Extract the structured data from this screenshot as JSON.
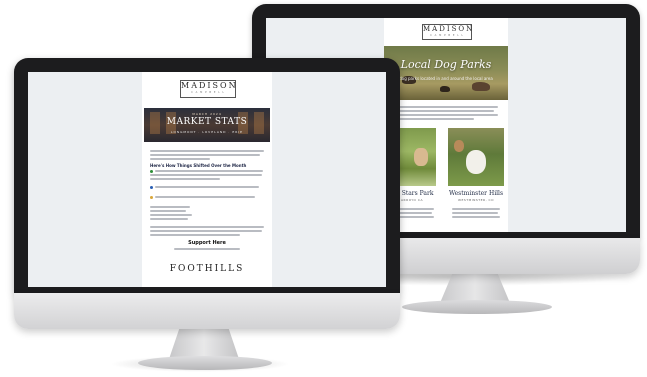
{
  "back_email": {
    "brand": "MADISON",
    "brand_sub": "C A M P B E L L",
    "hero_title": "Local Dog Parks",
    "hero_subtitle": "dog parks located in and around the local area",
    "parks": [
      {
        "name": "ald Stars Park",
        "city": "ARROYO CA"
      },
      {
        "name": "Westminster Hills",
        "city": "WESTMINSTER, CO"
      }
    ]
  },
  "front_email": {
    "brand": "MADISON",
    "brand_sub": "C A M P B E L L",
    "hero_kicker": "MARCH 2024",
    "hero_title": "MARKET STATS",
    "hero_subtitle": "LONGMONT · LOVELAND · ERIE",
    "section_heading": "Here's How Things Shifted Over the Month",
    "support_title": "Support Here",
    "footer_heading": "FOOTHILLS"
  },
  "colors": {
    "bezel": "#1c1c1e",
    "screen_bg": "#eceff2",
    "navy": "#1c2444"
  }
}
